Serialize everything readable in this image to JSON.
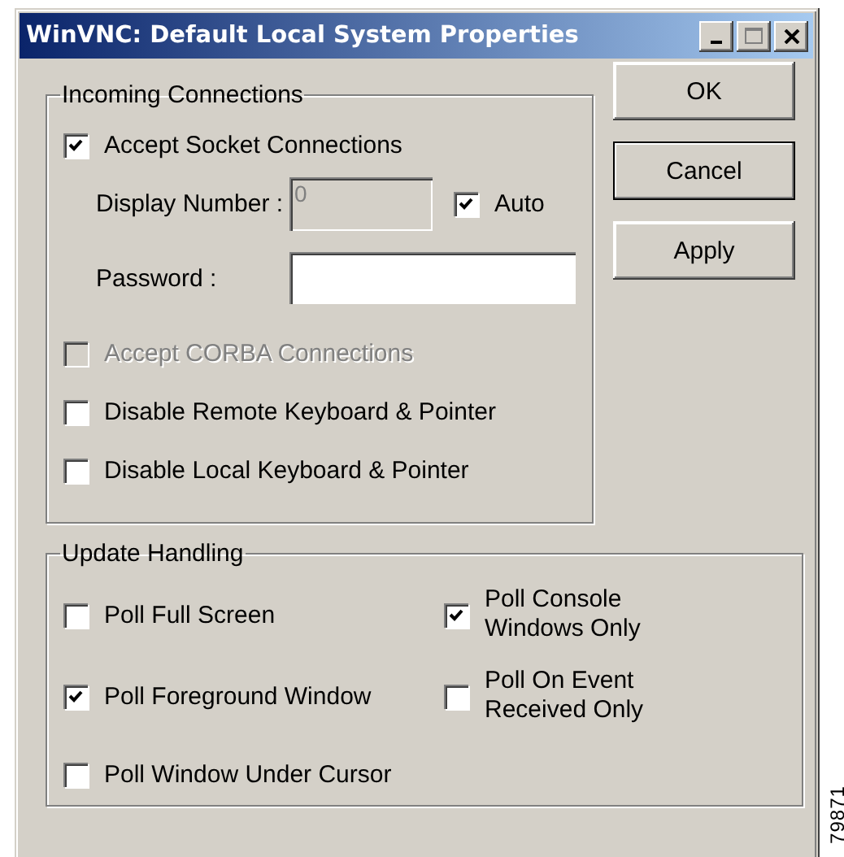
{
  "window": {
    "title": "WinVNC: Default Local System Properties"
  },
  "incoming": {
    "legend": "Incoming Connections",
    "accept_socket": {
      "label": "Accept Socket Connections",
      "checked": true,
      "disabled": false
    },
    "display_number": {
      "label": "Display Number :",
      "value": "0",
      "disabled": true
    },
    "auto": {
      "label": "Auto",
      "checked": true,
      "disabled": false
    },
    "password": {
      "label": "Password :"
    },
    "options": [
      {
        "label": "Accept CORBA Connections",
        "checked": false,
        "disabled": true
      },
      {
        "label": "Disable Remote Keyboard & Pointer",
        "checked": false,
        "disabled": false
      },
      {
        "label": "Disable Local Keyboard & Pointer",
        "checked": false,
        "disabled": false
      }
    ]
  },
  "buttons": [
    {
      "label": "OK",
      "focused": false
    },
    {
      "label": "Cancel",
      "focused": true
    },
    {
      "label": "Apply",
      "focused": false
    }
  ],
  "update": {
    "legend": "Update Handling",
    "options": [
      {
        "label": "Poll Full Screen",
        "checked": false
      },
      {
        "label": "Poll Console Windows Only",
        "checked": true
      },
      {
        "label": "Poll Foreground Window",
        "checked": true
      },
      {
        "label": "Poll On Event Received Only",
        "checked": false
      },
      {
        "label": "Poll Window Under Cursor",
        "checked": false
      }
    ]
  },
  "figure_number": "79871"
}
